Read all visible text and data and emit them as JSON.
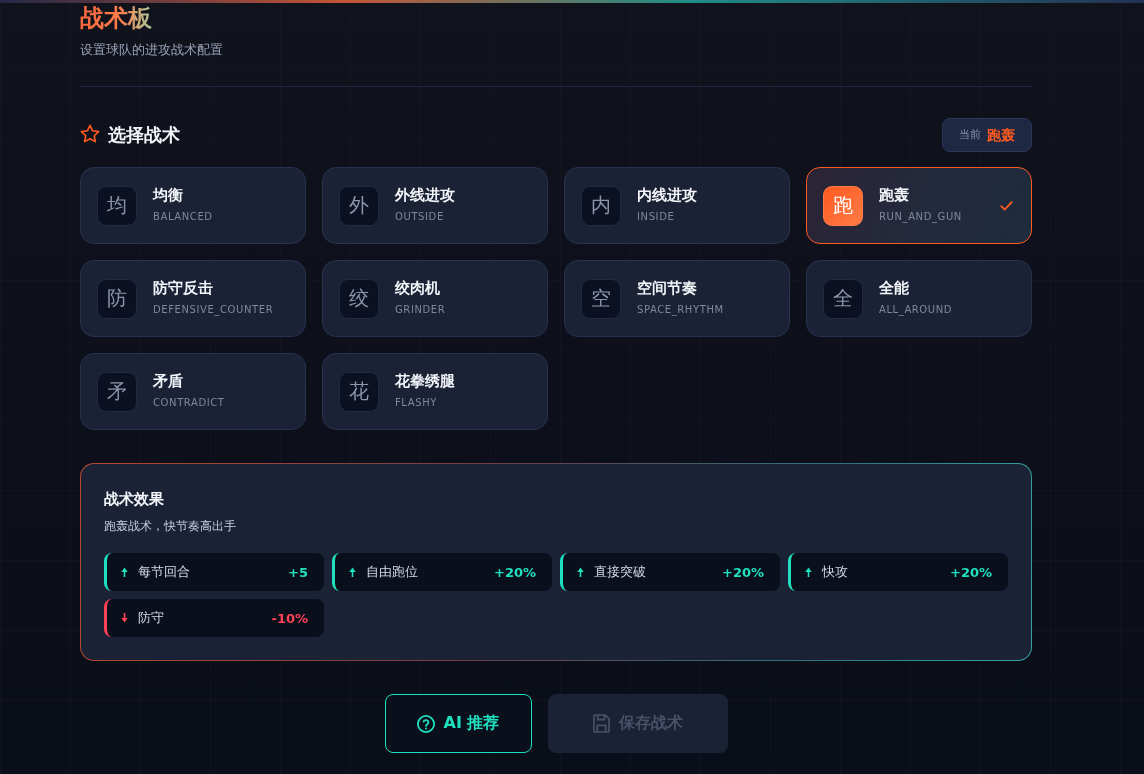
{
  "header": {
    "title": "战术板",
    "subtitle": "设置球队的进攻战术配置"
  },
  "tactic_section": {
    "title": "选择战术",
    "current": {
      "label": "当前",
      "value": "跑轰"
    }
  },
  "tactics": [
    {
      "glyph": "均",
      "name": "均衡",
      "code": "BALANCED",
      "selected": false
    },
    {
      "glyph": "外",
      "name": "外线进攻",
      "code": "OUTSIDE",
      "selected": false
    },
    {
      "glyph": "内",
      "name": "内线进攻",
      "code": "INSIDE",
      "selected": false
    },
    {
      "glyph": "跑",
      "name": "跑轰",
      "code": "RUN_AND_GUN",
      "selected": true
    },
    {
      "glyph": "防",
      "name": "防守反击",
      "code": "DEFENSIVE_COUNTER",
      "selected": false
    },
    {
      "glyph": "绞",
      "name": "绞肉机",
      "code": "GRINDER",
      "selected": false
    },
    {
      "glyph": "空",
      "name": "空间节奏",
      "code": "SPACE_RHYTHM",
      "selected": false
    },
    {
      "glyph": "全",
      "name": "全能",
      "code": "ALL_AROUND",
      "selected": false
    },
    {
      "glyph": "矛",
      "name": "矛盾",
      "code": "CONTRADICT",
      "selected": false
    },
    {
      "glyph": "花",
      "name": "花拳绣腿",
      "code": "FLASHY",
      "selected": false
    }
  ],
  "effects_panel": {
    "title": "战术效果",
    "description": "跑轰战术，快节奏高出手",
    "effects": [
      {
        "kind": "up",
        "label": "每节回合",
        "value": "+5"
      },
      {
        "kind": "up",
        "label": "自由跑位",
        "value": "+20%"
      },
      {
        "kind": "up",
        "label": "直接突破",
        "value": "+20%"
      },
      {
        "kind": "up",
        "label": "快攻",
        "value": "+20%"
      },
      {
        "kind": "down",
        "label": "防守",
        "value": "-10%"
      }
    ]
  },
  "buttons": [
    {
      "kind": "ai",
      "label": "AI 推荐",
      "disabled": false
    },
    {
      "kind": "save",
      "label": "保存战术",
      "disabled": true
    }
  ]
}
